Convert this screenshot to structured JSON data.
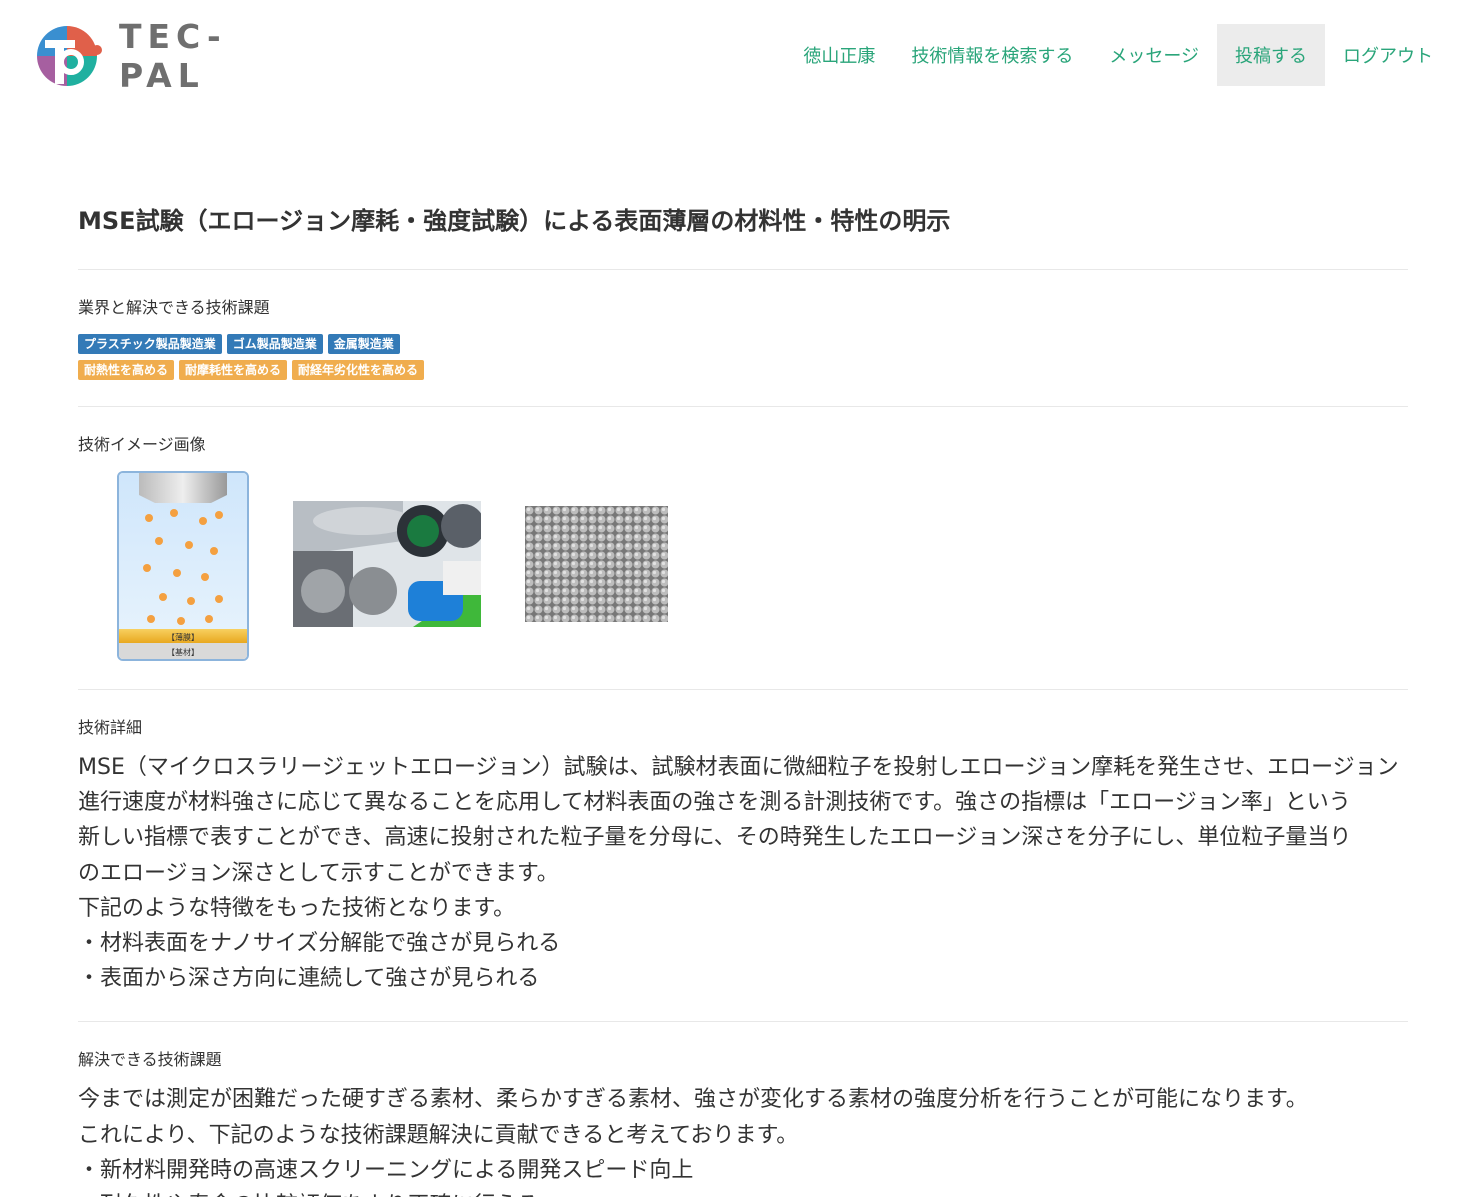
{
  "header": {
    "logo_text": "TEC-PAL",
    "nav": [
      {
        "label": "徳山正康"
      },
      {
        "label": "技術情報を検索する"
      },
      {
        "label": "メッセージ"
      },
      {
        "label": "投稿する"
      },
      {
        "label": "ログアウト"
      }
    ]
  },
  "article": {
    "title": "MSE試験（エロージョン摩耗・強度試験）による表面薄層の材料性・特性の明示",
    "industry_section_label": "業界と解決できる技術課題",
    "industry_tags": [
      "プラスチック製品製造業",
      "ゴム製品製造業",
      "金属製造業"
    ],
    "issue_tags": [
      "耐熱性を高める",
      "耐摩耗性を高める",
      "耐経年劣化性を高める"
    ],
    "image_section_label": "技術イメージ画像",
    "image_captions": [
      "【薄膜】",
      "【基材】"
    ],
    "detail_label": "技術詳細",
    "detail_text": "MSE（マイクロスラリージェットエロージョン）試験は、試験材表面に微細粒子を投射しエロージョン摩耗を発生させ、エロージョン\n進行速度が材料強さに応じて異なることを応用して材料表面の強さを測る計測技術です。強さの指標は「エロージョン率」という\n新しい指標で表すことができ、高速に投射された粒子量を分母に、その時発生したエロージョン深さを分子にし、単位粒子量当り\nのエロージョン深さとして示すことができます。\n下記のような特徴をもった技術となります。\n・材料表面をナノサイズ分解能で強さが見られる\n・表面から深さ方向に連続して強さが見られる",
    "issues_label": "解決できる技術課題",
    "issues_text": "今までは測定が困難だった硬すぎる素材、柔らかすぎる素材、強さが変化する素材の強度分析を行うことが可能になります。\nこれにより、下記のような技術課題解決に貢献できると考えております。\n・新材料開発時の高速スクリーニングによる開発スピード向上\n・耐久性や寿命の比較評価をより正確に行える"
  },
  "colors": {
    "nav_text": "#2aa57a",
    "nav_active_bg": "#ececec",
    "tag_blue": "#337ab7",
    "tag_orange": "#f0ad4e"
  }
}
